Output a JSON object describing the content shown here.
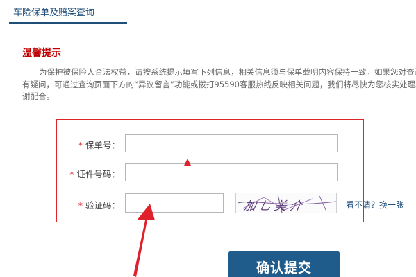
{
  "tabs": [
    {
      "label": "车险保单及赔案查询",
      "active": true
    }
  ],
  "notice": {
    "title": "温馨提示",
    "text": "为保护被保险人合法权益，请按系统提示填写下列信息，相关信息须与保单载明内容保持一致。如果您对查询结果有疑问，可通过查询页面下方的“异议留言”功能或拨打95590客服热线反映相关问题，我们将尽快为您核实处理。感谢配合。"
  },
  "form": {
    "required_mark": "*",
    "policy_number": {
      "label": "保单号：",
      "value": "",
      "placeholder": ""
    },
    "id_number": {
      "label": "证件号码：",
      "value": "",
      "placeholder": ""
    },
    "captcha": {
      "label": "验证码：",
      "value": "",
      "placeholder": "",
      "image_text": "加乚美介"
    },
    "refresh_label": "看不清？换一张"
  },
  "submit_label": "确认提交",
  "colors": {
    "accent_red": "#d9262b",
    "brand_blue": "#1f5c8b",
    "annotation_red": "#e0202a"
  }
}
